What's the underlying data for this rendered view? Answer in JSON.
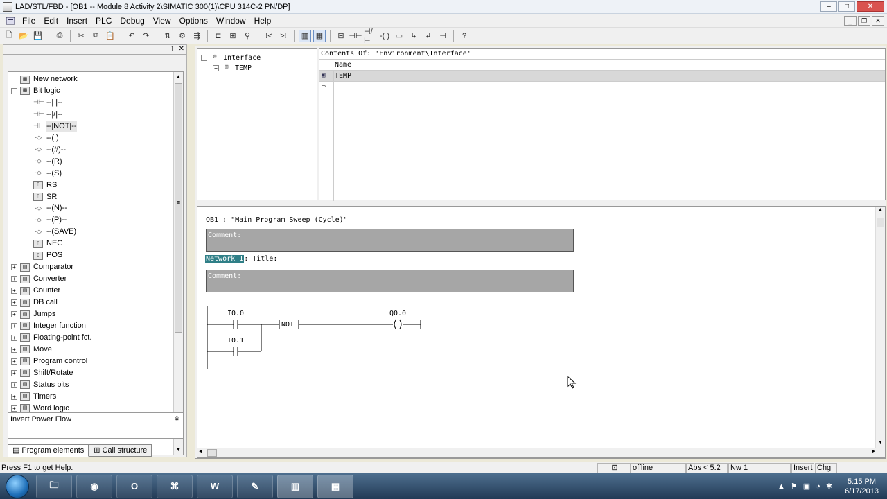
{
  "window": {
    "title": "LAD/STL/FBD  - [OB1 -- Module 8 Activity 2\\SIMATIC 300(1)\\CPU 314C-2 PN/DP]",
    "min": "–",
    "max": "□",
    "close": "✕"
  },
  "menu": [
    "File",
    "Edit",
    "Insert",
    "PLC",
    "Debug",
    "View",
    "Options",
    "Window",
    "Help"
  ],
  "toolbar_icons": [
    "new-icon",
    "open-icon",
    "save-icon",
    "print-icon",
    "cut-icon",
    "copy-icon",
    "paste-icon",
    "undo-icon",
    "redo-icon",
    "load-icon",
    "monitor-icon",
    "network-icon",
    "lad-icon",
    "fbd-icon",
    "contact-icon",
    "nc-contact-icon",
    "coil-icon",
    "box-icon",
    "branch-open-icon",
    "branch-close-icon",
    "help-icon"
  ],
  "tree": {
    "items": [
      {
        "label": "New network",
        "icon": "new-network-icon",
        "expander": ""
      },
      {
        "label": "Bit logic",
        "icon": "bit-logic-icon",
        "expander": "−"
      },
      {
        "label": "--| |--",
        "icon": "contact-icon",
        "indent": 1
      },
      {
        "label": "--|/|--",
        "icon": "contact-icon",
        "indent": 1
      },
      {
        "label": "--|NOT|--",
        "icon": "contact-icon",
        "indent": 1,
        "selected": true
      },
      {
        "label": "--( )",
        "icon": "coil-icon",
        "indent": 1
      },
      {
        "label": "--(#)--",
        "icon": "coil-icon",
        "indent": 1
      },
      {
        "label": "--(R)",
        "icon": "coil-icon",
        "indent": 1
      },
      {
        "label": "--(S)",
        "icon": "coil-icon",
        "indent": 1
      },
      {
        "label": "RS",
        "icon": "box-icon",
        "indent": 1
      },
      {
        "label": "SR",
        "icon": "box-icon",
        "indent": 1
      },
      {
        "label": "--(N)--",
        "icon": "coil-icon",
        "indent": 1
      },
      {
        "label": "--(P)--",
        "icon": "coil-icon",
        "indent": 1
      },
      {
        "label": "--(SAVE)",
        "icon": "coil-icon",
        "indent": 1
      },
      {
        "label": "NEG",
        "icon": "box-icon",
        "indent": 1
      },
      {
        "label": "POS",
        "icon": "box-icon",
        "indent": 1
      },
      {
        "label": "Comparator",
        "icon": "folder-icon",
        "expander": "+"
      },
      {
        "label": "Converter",
        "icon": "folder-icon",
        "expander": "+"
      },
      {
        "label": "Counter",
        "icon": "folder-icon",
        "expander": "+"
      },
      {
        "label": "DB call",
        "icon": "folder-icon",
        "expander": "+"
      },
      {
        "label": "Jumps",
        "icon": "folder-icon",
        "expander": "+"
      },
      {
        "label": "Integer function",
        "icon": "folder-icon",
        "expander": "+"
      },
      {
        "label": "Floating-point fct.",
        "icon": "folder-icon",
        "expander": "+"
      },
      {
        "label": "Move",
        "icon": "folder-icon",
        "expander": "+"
      },
      {
        "label": "Program control",
        "icon": "folder-icon",
        "expander": "+"
      },
      {
        "label": "Shift/Rotate",
        "icon": "folder-icon",
        "expander": "+"
      },
      {
        "label": "Status bits",
        "icon": "folder-icon",
        "expander": "+"
      },
      {
        "label": "Timers",
        "icon": "folder-icon",
        "expander": "+"
      },
      {
        "label": "Word logic",
        "icon": "folder-icon",
        "expander": "+"
      }
    ],
    "info": "Invert Power Flow",
    "tabs": [
      "Program elements",
      "Call structure"
    ]
  },
  "decl": {
    "tree_root": "Interface",
    "tree_child": "TEMP",
    "contents_label": "Contents Of: 'Environment\\Interface'",
    "col_name": "Name",
    "row1": "TEMP"
  },
  "editor": {
    "block_title": "OB1 :  \"Main Program Sweep (Cycle)\"",
    "comment_label": "Comment:",
    "network_label": "Network 1",
    "network_title": ": Title:",
    "network_comment": "Comment:",
    "contact1": "I0.0",
    "contact2": "I0.1",
    "not_label": "NOT",
    "coil": "Q0.0"
  },
  "status": {
    "help": "Press F1 to get Help.",
    "mode": "offline",
    "abs": "Abs < 5.2",
    "nw": "Nw 1",
    "insert": "Insert",
    "chg": "Chg"
  },
  "taskbar": {
    "time": "5:15 PM",
    "date": "6/17/2013",
    "apps": [
      "explorer-icon",
      "chrome-icon",
      "outlook-icon",
      "pdf-icon",
      "word-icon",
      "tool-icon",
      "step7-icon",
      "lad-editor-icon"
    ]
  }
}
